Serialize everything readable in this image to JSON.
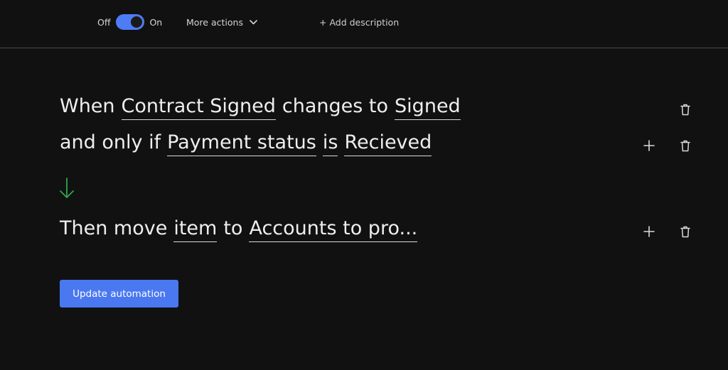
{
  "header": {
    "toggle_off_label": "Off",
    "toggle_on_label": "On",
    "toggle_state": "on",
    "more_actions_label": "More actions",
    "add_description_label": "+ Add description"
  },
  "rule": {
    "trigger": {
      "when_word": "When",
      "column": "Contract Signed",
      "changes_to_word": "changes to",
      "value": "Signed"
    },
    "condition": {
      "prefix": "and only if",
      "column": "Payment status",
      "operator": "is",
      "value": "Recieved"
    },
    "action": {
      "prefix": "Then move",
      "target": "item",
      "to_word": "to",
      "destination": "Accounts to pro..."
    }
  },
  "footer": {
    "update_button_label": "Update automation"
  },
  "colors": {
    "background": "#111111",
    "accent": "#4a78f0",
    "arrow": "#2fa84f",
    "text": "#eeeeee"
  },
  "icons": [
    "chevron-down-icon",
    "trash-icon",
    "plus-icon",
    "arrow-down-icon"
  ]
}
